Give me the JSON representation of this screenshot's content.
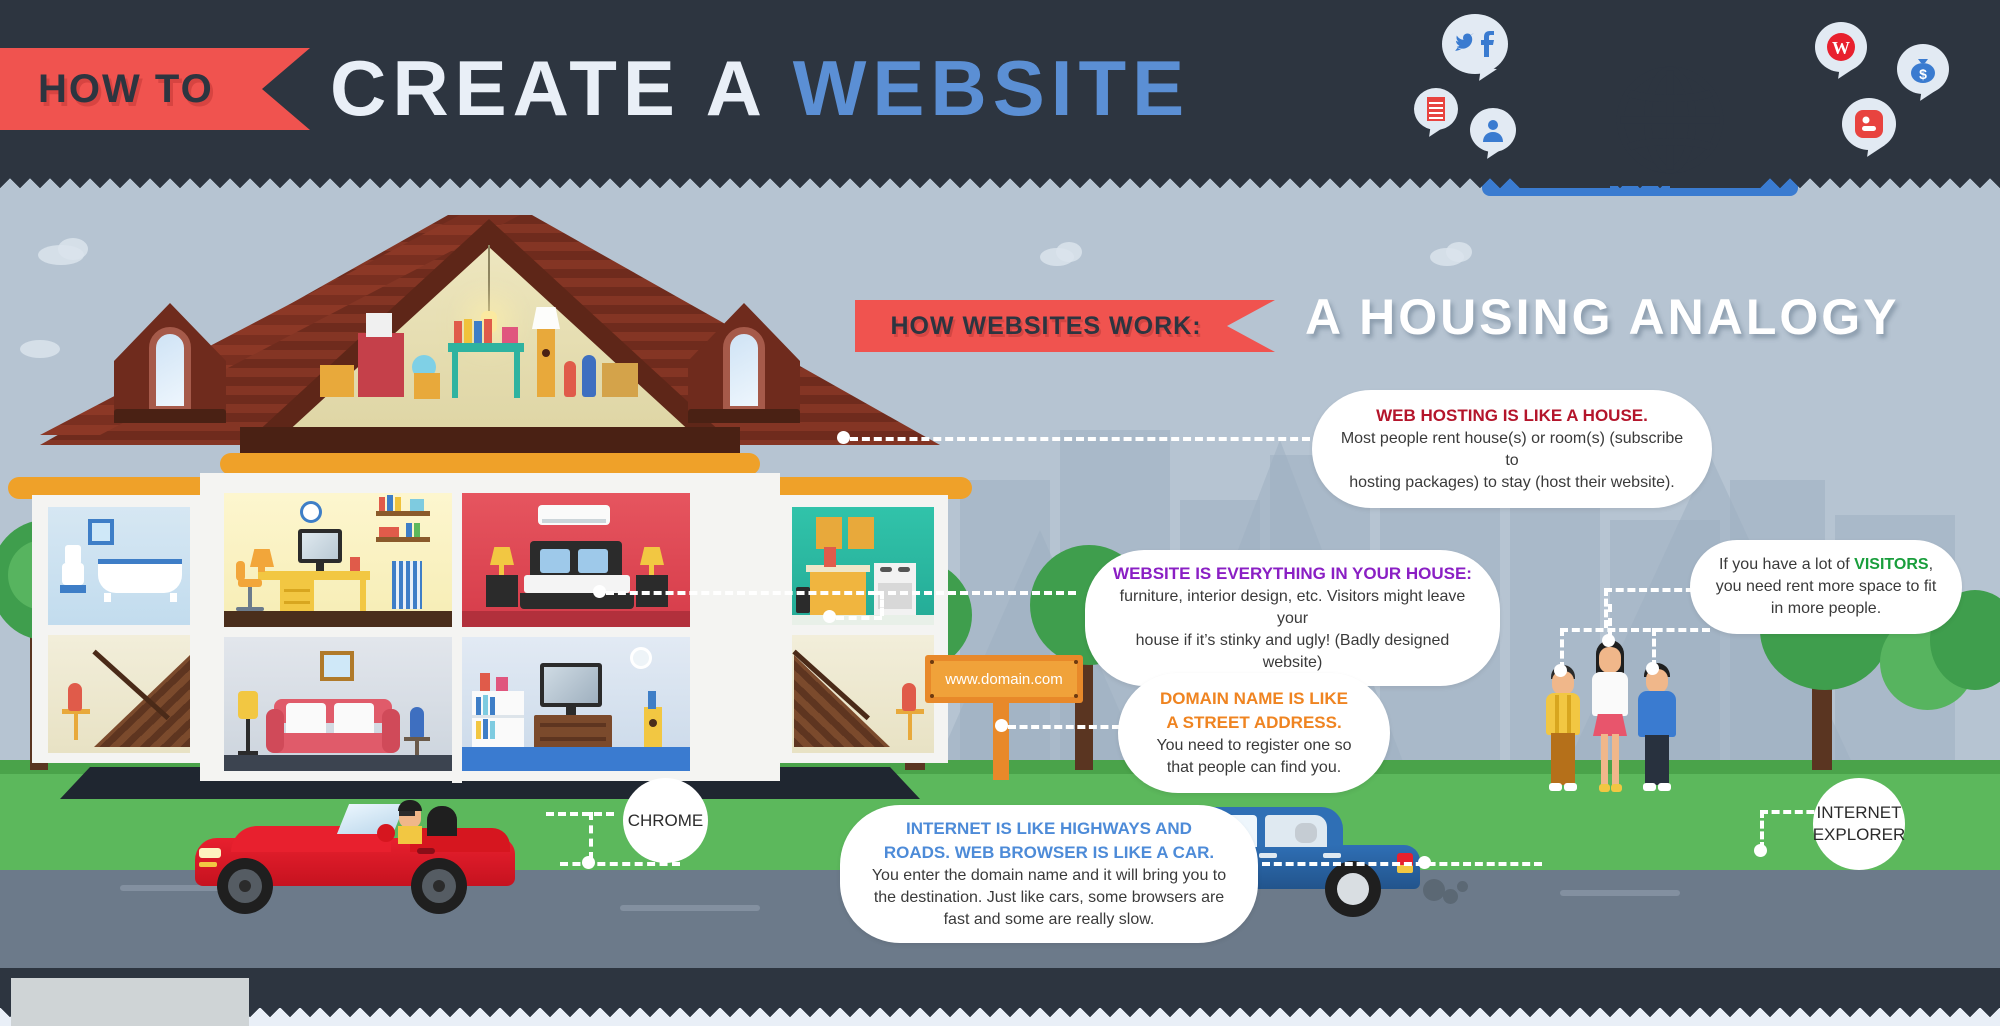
{
  "header": {
    "ribbon_label": "HOW TO",
    "title_part1": "CREATE A",
    "title_part2": "WEBSITE",
    "icons": [
      {
        "name": "twitter-icon",
        "glyph": "ᵗ"
      },
      {
        "name": "facebook-icon",
        "glyph": "f"
      },
      {
        "name": "article-icon",
        "glyph": "≡"
      },
      {
        "name": "user-icon",
        "glyph": "●"
      },
      {
        "name": "wordpress-icon",
        "glyph": "W"
      },
      {
        "name": "money-bag-icon",
        "glyph": "$"
      },
      {
        "name": "blogger-icon",
        "glyph": "B"
      }
    ],
    "laptop_label": "globe-icon"
  },
  "section": {
    "banner_label": "HOW WEBSITES WORK:",
    "subtitle": "A HOUSING ANALOGY"
  },
  "callouts": {
    "hosting": {
      "headline": "WEB HOSTING IS LIKE A HOUSE.",
      "body_line1": "Most people rent house(s) or room(s) (subscribe to",
      "body_line2": "hosting packages) to stay (host their website).",
      "color": "#b4152b"
    },
    "website": {
      "headline": "WEBSITE IS EVERYTHING IN YOUR HOUSE:",
      "body_line1": "furniture, interior design, etc. Visitors might leave your",
      "body_line2": "house if it’s stinky and ugly! (Badly designed website)",
      "color": "#8a1fc4"
    },
    "visitors": {
      "body_pre": "If you have a lot of ",
      "highlight": "VISITORS",
      "body_post": ",",
      "body_line2": "you need rent more space to fit",
      "body_line3": "in more people.",
      "highlight_color": "#199e3c"
    },
    "domain": {
      "headline_line1": "DOMAIN NAME IS LIKE",
      "headline_line2": "A STREET ADDRESS.",
      "body_line1": "You need to register one so",
      "body_line2": "that people can find you.",
      "color": "#ef8421"
    },
    "internet": {
      "headline_line1": "INTERNET IS LIKE HIGHWAYS AND",
      "headline_line2": "ROADS. WEB BROWSER IS LIKE A CAR.",
      "body_line1": "You enter the domain name and it will bring you to",
      "body_line2": "the destination. Just like cars, some browsers are",
      "body_line3": "fast and some are really slow.",
      "color": "#4d8bd8"
    }
  },
  "badges": {
    "chrome": "CHROME",
    "ie_line1": "INTERNET",
    "ie_line2": "EXPLORER"
  },
  "sign": {
    "domain_text": "www.domain.com"
  },
  "colors": {
    "dark": "#2d3540",
    "red": "#f0534f",
    "blue": "#5b8fd4",
    "sky": "#b6c4d2",
    "grass": "#5cb85c",
    "road": "#6c7a8a",
    "roof": "#7a2f20",
    "eave": "#efa129"
  }
}
